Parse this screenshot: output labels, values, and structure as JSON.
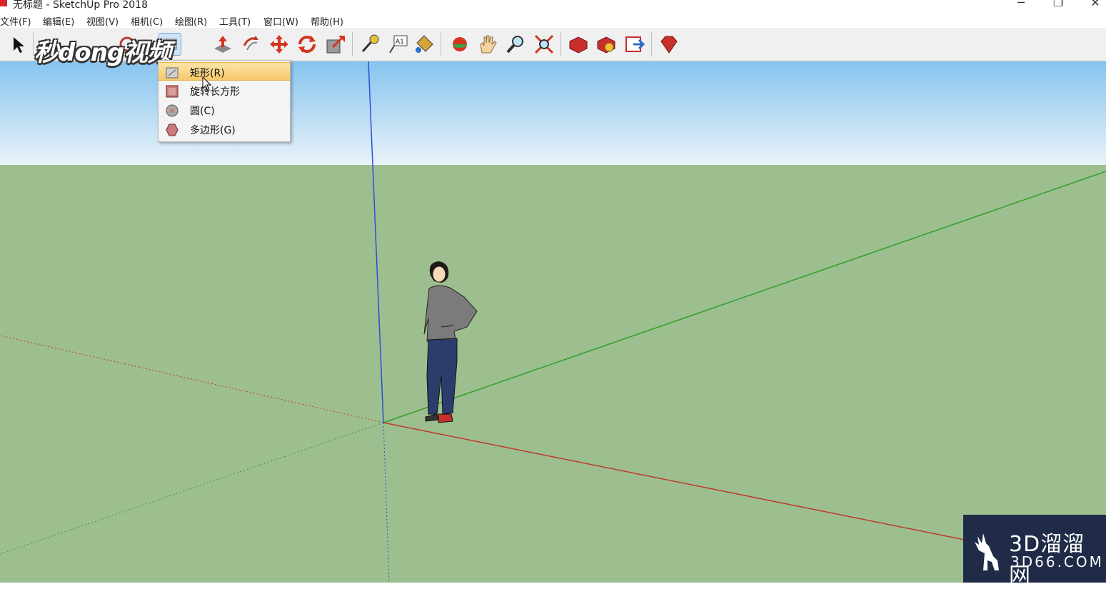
{
  "window": {
    "title": "无标题 - SketchUp Pro 2018",
    "minimize": "─",
    "restore": "❐",
    "close": "✕"
  },
  "menubar": {
    "items": [
      "文件(F)",
      "编辑(E)",
      "视图(V)",
      "相机(C)",
      "绘图(R)",
      "工具(T)",
      "窗口(W)",
      "帮助(H)"
    ]
  },
  "toolbar": {
    "tools": [
      "select",
      "eraser",
      "rectangle",
      "push-pull",
      "offset",
      "move",
      "rotate",
      "scale",
      "tape-measure",
      "text",
      "paint-bucket",
      "orbit",
      "pan",
      "zoom",
      "zoom-extents",
      "3d-warehouse",
      "extension-warehouse",
      "send-to-layout",
      "extension-manager"
    ]
  },
  "dropdown": {
    "items": [
      {
        "label": "矩形(R)",
        "icon": "rectangle-icon",
        "highlighted": true
      },
      {
        "label": "旋转长方形",
        "icon": "rotated-rectangle-icon",
        "highlighted": false
      },
      {
        "label": "圆(C)",
        "icon": "circle-icon",
        "highlighted": false
      },
      {
        "label": "多边形(G)",
        "icon": "polygon-icon",
        "highlighted": false
      }
    ]
  },
  "watermark": {
    "text": "秒dong视频"
  },
  "logo": {
    "main": "3D溜溜网",
    "sub": "3D66.COM"
  },
  "colors": {
    "sky_top": "#86c3ee",
    "sky_bottom": "#e9f3f8",
    "ground": "#9dbf8f",
    "axis_red": "#c0392b",
    "axis_green": "#2ca02c",
    "axis_blue": "#2b4fd8",
    "menu_highlight": "#f7c86a"
  }
}
